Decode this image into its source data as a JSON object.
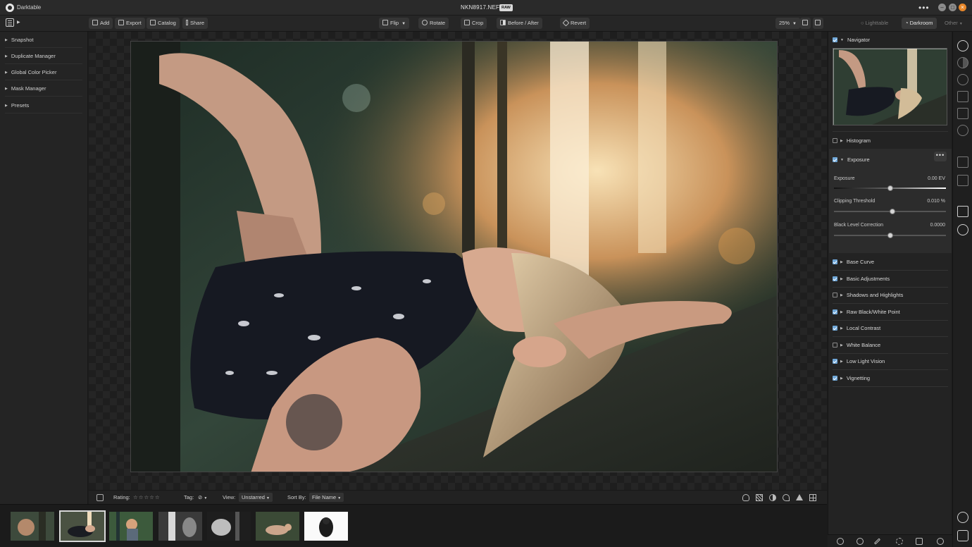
{
  "window": {
    "app_name": "Darktable",
    "file_name": "NKN8917.NEF",
    "file_badge": "RAW",
    "more": "•••"
  },
  "toolbar": {
    "add": "Add",
    "export": "Export",
    "catalog": "Catalog",
    "share": "Share",
    "flip": "Flip",
    "rotate": "Rotate",
    "crop": "Crop",
    "before_after": "Before / After",
    "revert": "Revert",
    "zoom": "25%",
    "lighttable": "Lighttable",
    "darkroom": "Darkroom",
    "other": "Other"
  },
  "left_panel": {
    "items": [
      "Snapshot",
      "Duplicate Manager",
      "Global Color Picker",
      "Mask Manager",
      "Presets"
    ]
  },
  "filter_bar": {
    "rating_label": "Rating:",
    "tag_label": "Tag:",
    "view_label": "View:",
    "view_value": "Unstarred",
    "sort_label": "Sort By:",
    "sort_value": "File Name"
  },
  "right_panel": {
    "navigator": "Navigator",
    "histogram": "Histogram",
    "exposure_module": "Exposure",
    "sliders": [
      {
        "label": "Exposure",
        "value": "0.00 EV",
        "position": 0.5
      },
      {
        "label": "Clipping Threshold",
        "value": "0.010 %",
        "position": 0.52
      },
      {
        "label": "Black Level Correction",
        "value": "0.0000",
        "position": 0.5
      }
    ],
    "modules": [
      {
        "label": "Base Curve",
        "enabled": true
      },
      {
        "label": "Basic Adjustments",
        "enabled": true
      },
      {
        "label": "Shadows and Highlights",
        "enabled": false
      },
      {
        "label": "Raw Black/White Point",
        "enabled": true
      },
      {
        "label": "Local Contrast",
        "enabled": true
      },
      {
        "label": "White Balance",
        "enabled": false
      },
      {
        "label": "Low Light Vision",
        "enabled": true
      },
      {
        "label": "Vignetting",
        "enabled": true
      }
    ]
  },
  "icons": {
    "sidebar_toggle": "sidebar-icon",
    "rail": [
      "target-icon",
      "half-circle-icon",
      "circles-icon",
      "triangle-icon",
      "bars-icon",
      "more-icon",
      "star-icon",
      "check-icon",
      "layers-icon",
      "history-icon",
      "info-icon",
      "tag-icon"
    ]
  }
}
